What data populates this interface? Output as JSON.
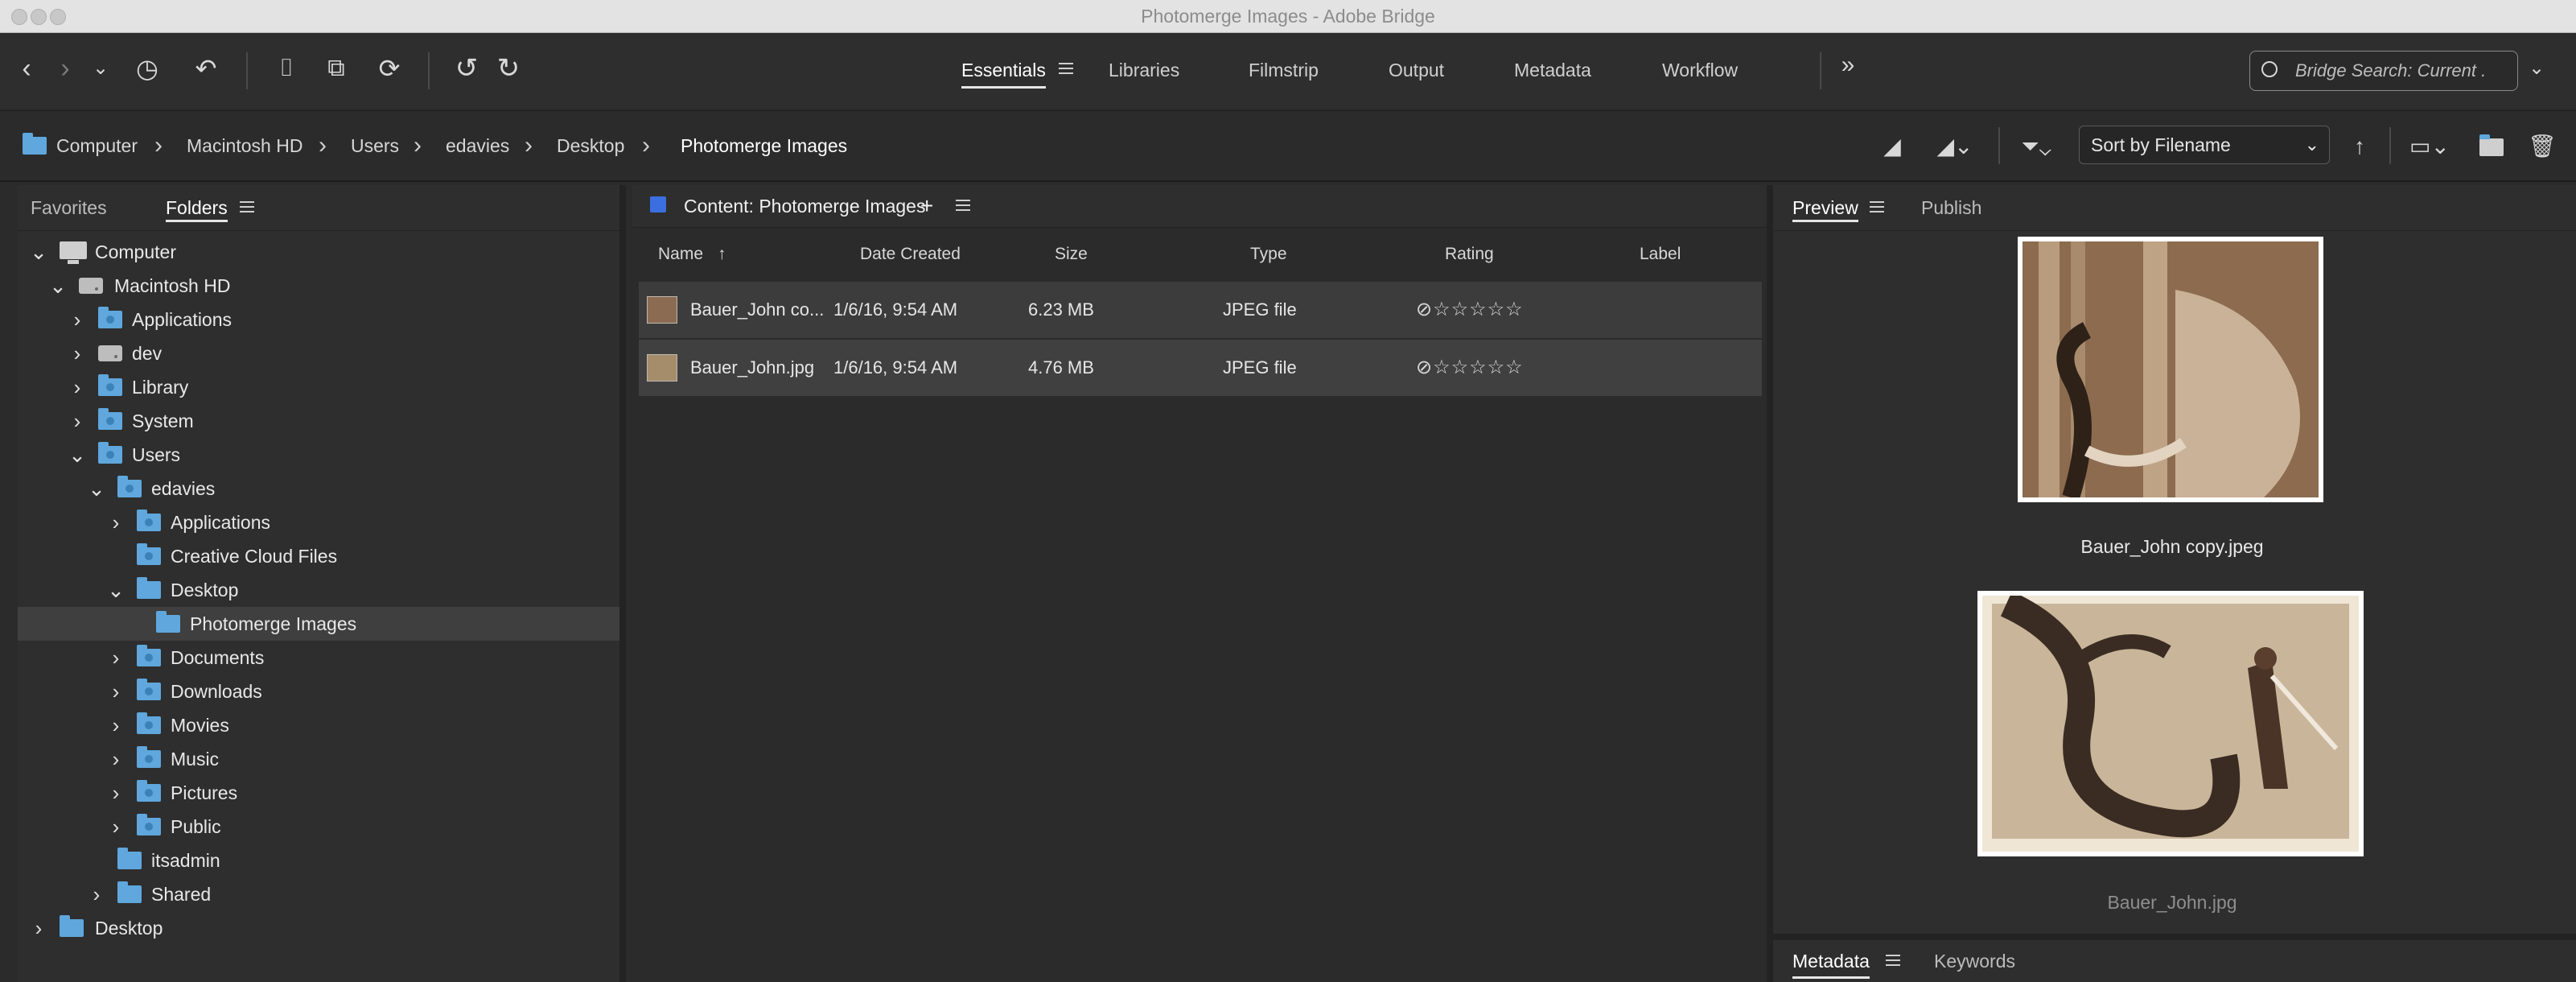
{
  "window": {
    "title": "Photomerge Images - Adobe Bridge"
  },
  "workspaces": {
    "tabs": [
      {
        "label": "Essentials",
        "active": true
      },
      {
        "label": "Libraries"
      },
      {
        "label": "Filmstrip"
      },
      {
        "label": "Output"
      },
      {
        "label": "Metadata"
      },
      {
        "label": "Workflow"
      }
    ],
    "more": "»"
  },
  "search": {
    "placeholder": "Bridge Search: Current ."
  },
  "breadcrumb": [
    "Computer",
    "Macintosh HD",
    "Users",
    "edavies",
    "Desktop",
    "Photomerge Images"
  ],
  "sort": {
    "label": "Sort by Filename"
  },
  "left_panel": {
    "tabs": [
      "Favorites",
      "Folders"
    ],
    "active": "Folders"
  },
  "tree": [
    {
      "label": "Computer",
      "expanded": true,
      "icon": "computer-icon"
    },
    {
      "label": "Macintosh HD",
      "expanded": true,
      "icon": "hard-drive-icon"
    },
    {
      "label": "Applications",
      "expanded": false,
      "icon": "folder-icon"
    },
    {
      "label": "dev",
      "expanded": false,
      "icon": "hard-drive-icon"
    },
    {
      "label": "Library",
      "expanded": false,
      "icon": "folder-icon"
    },
    {
      "label": "System",
      "expanded": false,
      "icon": "folder-icon"
    },
    {
      "label": "Users",
      "expanded": true,
      "icon": "folder-icon"
    },
    {
      "label": "edavies",
      "expanded": true,
      "icon": "folder-icon"
    },
    {
      "label": "Applications",
      "expanded": false,
      "icon": "folder-icon"
    },
    {
      "label": "Creative Cloud Files",
      "icon": "folder-icon"
    },
    {
      "label": "Desktop",
      "expanded": true,
      "icon": "folder-icon"
    },
    {
      "label": "Photomerge Images",
      "selected": true,
      "icon": "folder-icon"
    },
    {
      "label": "Documents",
      "expanded": false,
      "icon": "folder-icon"
    },
    {
      "label": "Downloads",
      "expanded": false,
      "icon": "folder-icon"
    },
    {
      "label": "Movies",
      "expanded": false,
      "icon": "folder-icon"
    },
    {
      "label": "Music",
      "expanded": false,
      "icon": "folder-icon"
    },
    {
      "label": "Pictures",
      "expanded": false,
      "icon": "folder-icon"
    },
    {
      "label": "Public",
      "expanded": false,
      "icon": "folder-icon"
    },
    {
      "label": "itsadmin",
      "icon": "folder-icon"
    },
    {
      "label": "Shared",
      "expanded": false,
      "icon": "folder-icon"
    },
    {
      "label": "Desktop",
      "expanded": false,
      "icon": "folder-icon"
    }
  ],
  "content": {
    "title": "Content: Photomerge Images",
    "columns": {
      "name": "Name",
      "date": "Date Created",
      "size": "Size",
      "type": "Type",
      "rating": "Rating",
      "label": "Label"
    },
    "files": [
      {
        "name": "Bauer_John co...",
        "date": "1/6/16, 9:54 AM",
        "size": "6.23 MB",
        "type": "JPEG file",
        "rating": "⊘☆☆☆☆☆"
      },
      {
        "name": "Bauer_John.jpg",
        "date": "1/6/16, 9:54 AM",
        "size": "4.76 MB",
        "type": "JPEG file",
        "rating": "⊘☆☆☆☆☆"
      }
    ]
  },
  "right_panel": {
    "tabs": [
      "Preview",
      "Publish"
    ],
    "previews": [
      {
        "caption": "Bauer_John copy.jpeg",
        "caption_color": "#e8e8e8"
      },
      {
        "caption": "Bauer_John.jpg",
        "caption_color": "#8e8e8e"
      }
    ],
    "bottom_tabs": [
      "Metadata",
      "Keywords"
    ]
  },
  "colors": {
    "accent": "#3b6fe0",
    "folder": "#5fa7dd",
    "panel": "#2e2e2e"
  }
}
